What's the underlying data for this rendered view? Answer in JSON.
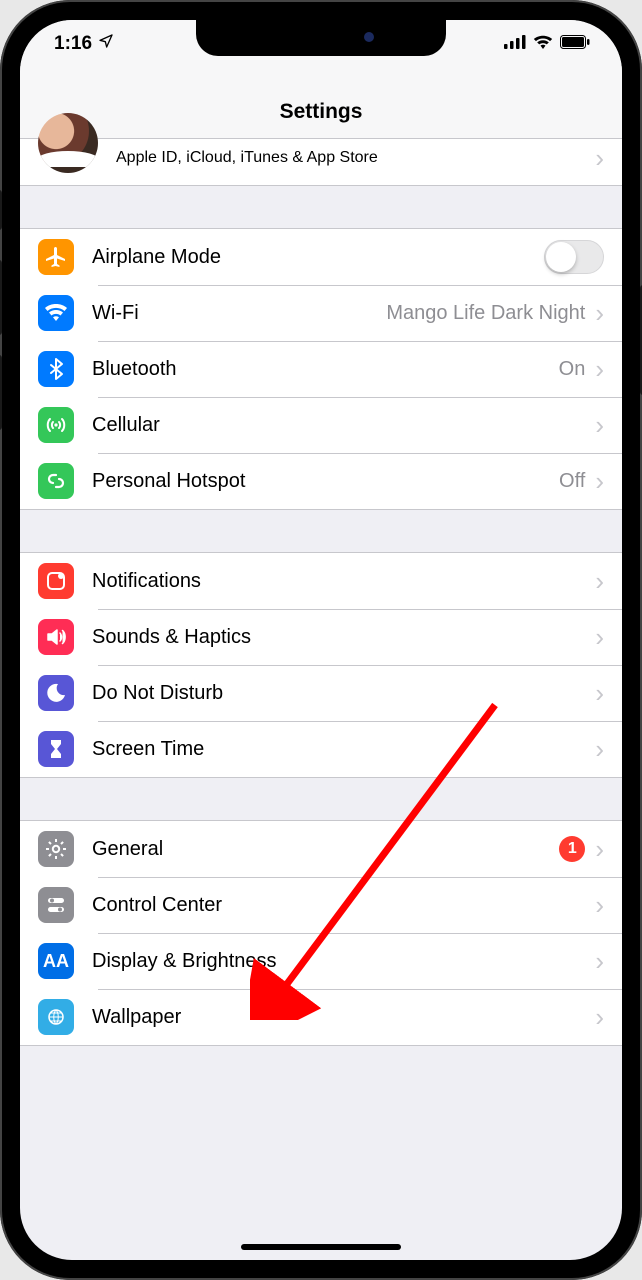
{
  "status": {
    "time": "1:16"
  },
  "header": {
    "title": "Settings"
  },
  "appleId": {
    "subtitle": "Apple ID, iCloud, iTunes & App Store"
  },
  "group1": {
    "airplane": {
      "label": "Airplane Mode",
      "on": false
    },
    "wifi": {
      "label": "Wi-Fi",
      "value": "Mango Life Dark Night"
    },
    "bluetooth": {
      "label": "Bluetooth",
      "value": "On"
    },
    "cellular": {
      "label": "Cellular"
    },
    "hotspot": {
      "label": "Personal Hotspot",
      "value": "Off"
    }
  },
  "group2": {
    "notifications": {
      "label": "Notifications"
    },
    "sounds": {
      "label": "Sounds & Haptics"
    },
    "dnd": {
      "label": "Do Not Disturb"
    },
    "screentime": {
      "label": "Screen Time"
    }
  },
  "group3": {
    "general": {
      "label": "General",
      "badge": "1"
    },
    "controlcenter": {
      "label": "Control Center"
    },
    "display": {
      "label": "Display & Brightness"
    },
    "wallpaper": {
      "label": "Wallpaper"
    }
  }
}
